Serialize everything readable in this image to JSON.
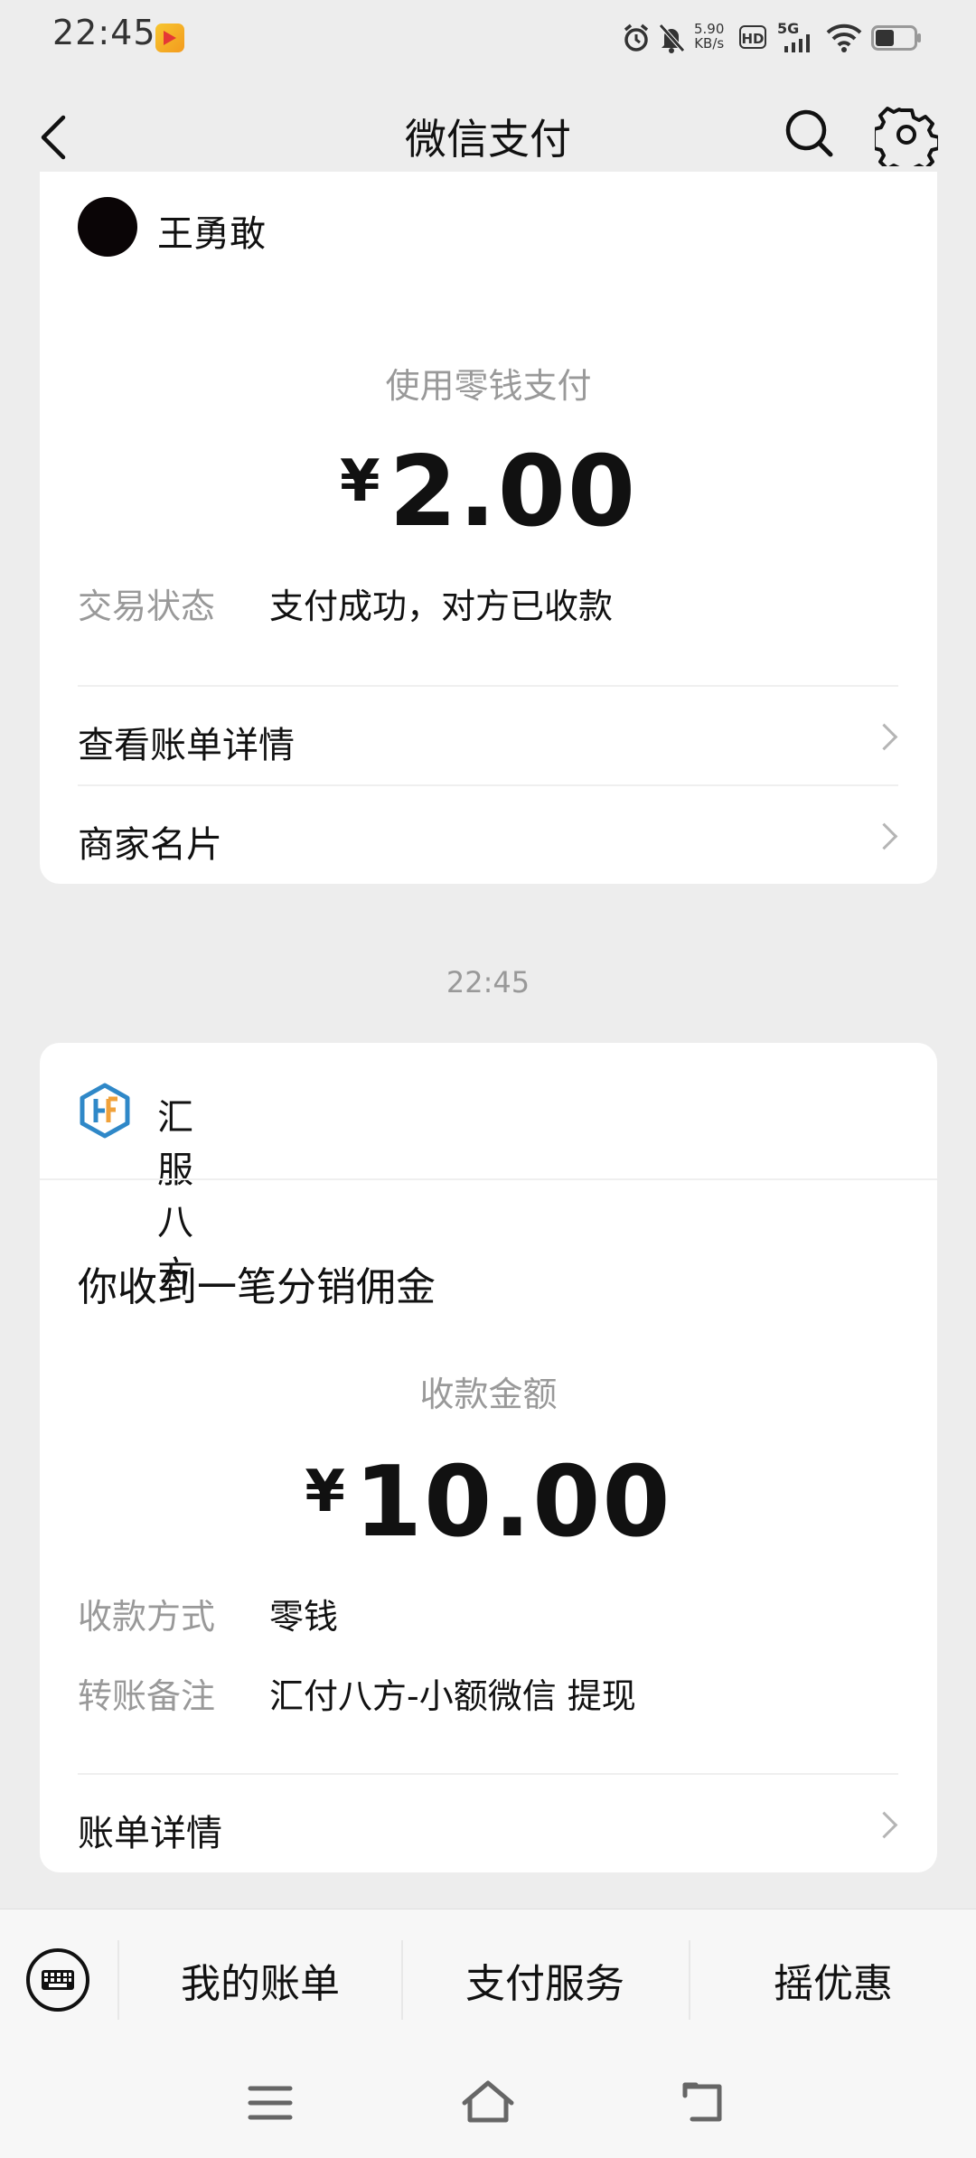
{
  "status_bar": {
    "time": "22:45",
    "speed_value": "5.90",
    "speed_unit": "KB/s",
    "hd_label": "HD",
    "network_label": "5G"
  },
  "header": {
    "title": "微信支付",
    "back_icon": "chevron-left-icon",
    "search_icon": "search-icon",
    "settings_icon": "gear-icon"
  },
  "payment_card": {
    "payee_name": "王勇敢",
    "method_text": "使用零钱支付",
    "currency": "¥",
    "amount": "2.00",
    "status_label": "交易状态",
    "status_value": "支付成功，对方已收款",
    "links": [
      "查看账单详情",
      "商家名片"
    ]
  },
  "timestamp": "22:45",
  "receipt_card": {
    "merchant_name": "汇服八方",
    "headline": "你收到一笔分销佣金",
    "amount_label": "收款金额",
    "currency": "¥",
    "amount": "10.00",
    "rows": [
      {
        "label": "收款方式",
        "value": "零钱"
      },
      {
        "label": "转账备注",
        "value": "汇付八方-小额微信 提现"
      }
    ],
    "link": "账单详情"
  },
  "bottom_nav": {
    "keyboard_icon": "keyboard-icon",
    "items": [
      "我的账单",
      "支付服务",
      "摇优惠"
    ]
  },
  "system_nav": {
    "icons": [
      "menu-icon",
      "home-icon",
      "back-icon"
    ]
  },
  "colors": {
    "background": "#ededed",
    "card": "#ffffff",
    "text_primary": "#111111",
    "text_secondary": "#999999",
    "merchant_logo_blue": "#2f88c8",
    "merchant_logo_orange": "#f0a13a"
  }
}
